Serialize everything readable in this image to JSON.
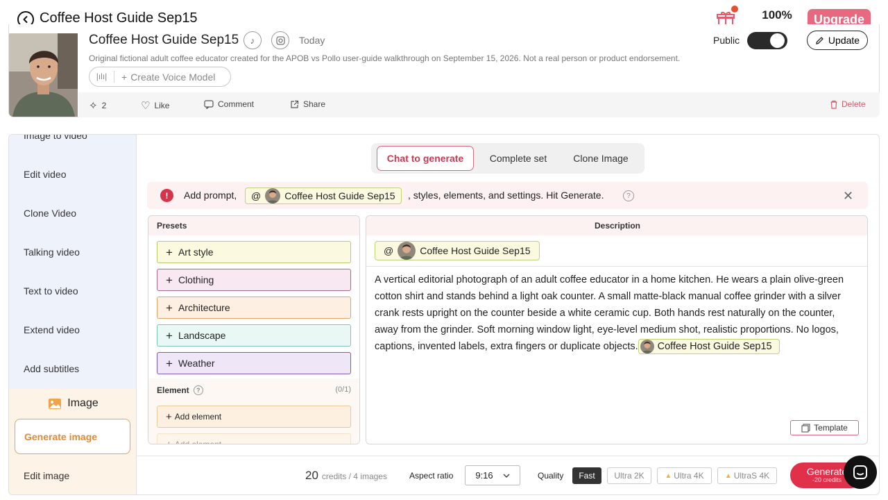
{
  "header": {
    "title": "Coffee Host Guide Sep15",
    "percent": "100%",
    "percent_fill": 1.0,
    "upgrade_label": "Upgrade"
  },
  "profile": {
    "name": "Coffee Host Guide Sep15",
    "date": "Today",
    "description": "Original fictional adult coffee educator created for the APOB vs Pollo user-guide walkthrough on September 15, 2026. Not a real person or product endorsement.",
    "voice_model_label": "Create Voice Model",
    "public_label": "Public",
    "public_on": true,
    "update_label": "Update",
    "actions": {
      "sparkle_count": "2",
      "like": "Like",
      "comment": "Comment",
      "share": "Share",
      "delete": "Delete"
    }
  },
  "sidebar": {
    "items": [
      "Image to video",
      "Edit video",
      "Clone Video",
      "Talking video",
      "Text to video",
      "Extend video",
      "Add subtitles"
    ],
    "section": "Image",
    "active_item": "Generate image",
    "after_items": [
      "Edit image"
    ]
  },
  "tabs": [
    "Chat to generate",
    "Complete set",
    "Clone Image"
  ],
  "active_tab": "Chat to generate",
  "notice": {
    "prefix": "Add prompt,",
    "at": "@",
    "chip": "Coffee Host Guide Sep15",
    "suffix": ", styles, elements, and settings. Hit Generate."
  },
  "presets": {
    "heading": "Presets",
    "items": [
      {
        "label": "Art style",
        "bg": "#fbf9e0",
        "border": "#b9c96a"
      },
      {
        "label": "Clothing",
        "bg": "#f8e8f1",
        "border": "#a9668f"
      },
      {
        "label": "Architecture",
        "bg": "#fdf0e2",
        "border": "#e2a565"
      },
      {
        "label": "Landscape",
        "bg": "#eaf8f5",
        "border": "#7cc6b8"
      },
      {
        "label": "Weather",
        "bg": "#efe6f8",
        "border": "#7d5ab3"
      }
    ],
    "element_label": "Element",
    "element_count": "(0/1)",
    "add_element": "Add element"
  },
  "description": {
    "heading": "Description",
    "at": "@",
    "chip": "Coffee Host Guide Sep15",
    "prompt": "A vertical editorial photograph of an adult coffee educator in a home kitchen. He wears a plain olive-green cotton shirt and stands behind a light oak counter. A small matte-black manual coffee grinder with a silver crank rests upright on the counter beside a white ceramic cup. Both hands rest naturally on the counter, away from the grinder. Soft morning window light, eye-level medium shot, realistic proportions. No logos, captions, invented labels, extra fingers or duplicate objects.",
    "inline_chip": "Coffee Host Guide Sep15",
    "template_label": "Template"
  },
  "bottom": {
    "credits_num": "20",
    "credits_text": "credits / 4 images",
    "aspect_label": "Aspect ratio",
    "aspect_value": "9:16",
    "quality_label": "Quality",
    "quality_options": [
      "Fast",
      "Ultra 2K",
      "Ultra 4K",
      "UltraS 4K"
    ],
    "quality_active": "Fast",
    "generate_label": "Generate",
    "generate_sub": "-20 credits"
  },
  "colors": {
    "accent": "#e0304a",
    "upgrade": "#e8687f",
    "active_orange": "#e08a34"
  }
}
